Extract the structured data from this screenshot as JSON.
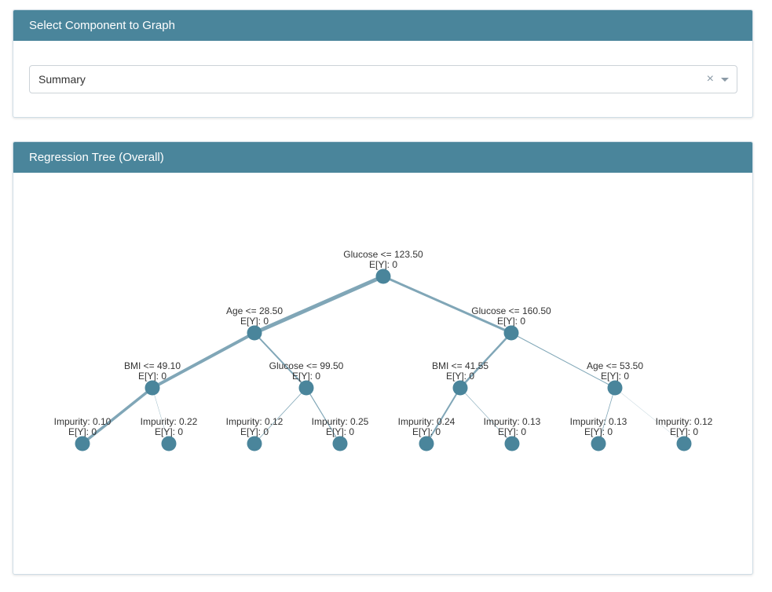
{
  "select_panel": {
    "title": "Select Component to Graph",
    "selected_value": "Summary",
    "clear_icon": "×",
    "dropdown_icon": "chevron-down-icon"
  },
  "tree_panel": {
    "title": "Regression Tree (Overall)"
  },
  "colors": {
    "header": "#4a859b",
    "node": "#4a859b",
    "edge": "#6a97aa"
  },
  "tree": {
    "nodes": [
      {
        "id": "root",
        "label": "Glucose <= 123.50",
        "value": "E[Y]: 0"
      },
      {
        "id": "n1",
        "label": "Age <= 28.50",
        "value": "E[Y]: 0"
      },
      {
        "id": "n2",
        "label": "Glucose <= 160.50",
        "value": "E[Y]: 0"
      },
      {
        "id": "n3",
        "label": "BMI <= 49.10",
        "value": "E[Y]: 0"
      },
      {
        "id": "n4",
        "label": "Glucose <= 99.50",
        "value": "E[Y]: 0"
      },
      {
        "id": "n5",
        "label": "BMI <= 41.55",
        "value": "E[Y]: 0"
      },
      {
        "id": "n6",
        "label": "Age <= 53.50",
        "value": "E[Y]: 0"
      },
      {
        "id": "l1",
        "label": "Impurity: 0.10",
        "value": "E[Y]: 0"
      },
      {
        "id": "l2",
        "label": "Impurity: 0.22",
        "value": "E[Y]: 0"
      },
      {
        "id": "l3",
        "label": "Impurity: 0.12",
        "value": "E[Y]: 0"
      },
      {
        "id": "l4",
        "label": "Impurity: 0.25",
        "value": "E[Y]: 0"
      },
      {
        "id": "l5",
        "label": "Impurity: 0.24",
        "value": "E[Y]: 0"
      },
      {
        "id": "l6",
        "label": "Impurity: 0.13",
        "value": "E[Y]: 0"
      },
      {
        "id": "l7",
        "label": "Impurity: 0.13",
        "value": "E[Y]: 0"
      },
      {
        "id": "l8",
        "label": "Impurity: 0.12",
        "value": "E[Y]: 0"
      }
    ],
    "edges": [
      {
        "from": "root",
        "to": "n1",
        "weight": 5
      },
      {
        "from": "root",
        "to": "n2",
        "weight": 3
      },
      {
        "from": "n1",
        "to": "n3",
        "weight": 4
      },
      {
        "from": "n1",
        "to": "n4",
        "weight": 2
      },
      {
        "from": "n2",
        "to": "n5",
        "weight": 2.5
      },
      {
        "from": "n2",
        "to": "n6",
        "weight": 1
      },
      {
        "from": "n3",
        "to": "l1",
        "weight": 3.5
      },
      {
        "from": "n3",
        "to": "l2",
        "weight": 0.4
      },
      {
        "from": "n4",
        "to": "l3",
        "weight": 0.8
      },
      {
        "from": "n4",
        "to": "l4",
        "weight": 1.2
      },
      {
        "from": "n5",
        "to": "l5",
        "weight": 2
      },
      {
        "from": "n5",
        "to": "l6",
        "weight": 0.6
      },
      {
        "from": "n6",
        "to": "l7",
        "weight": 0.8
      },
      {
        "from": "n6",
        "to": "l8",
        "weight": 0.3
      }
    ]
  }
}
